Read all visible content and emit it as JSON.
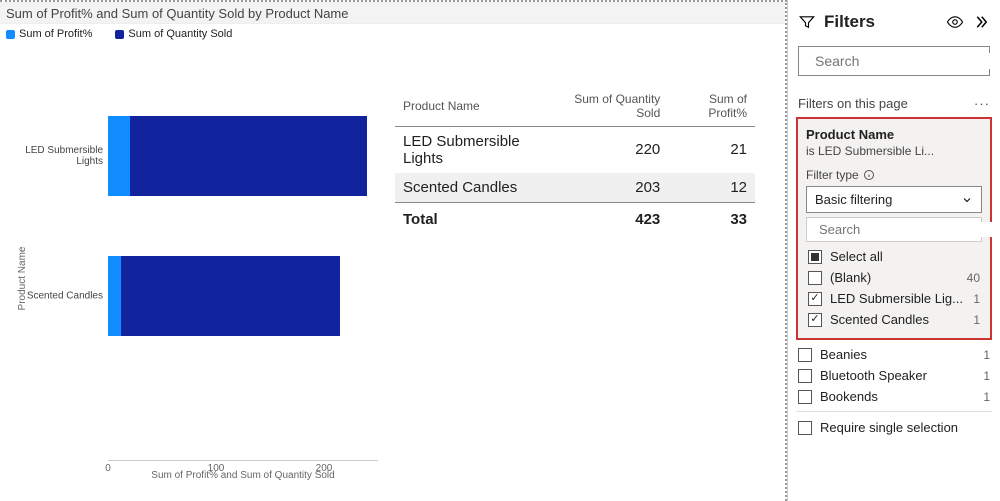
{
  "chart_data": {
    "type": "bar",
    "orientation": "horizontal",
    "stacked": true,
    "title": "Sum of Profit% and Sum of Quantity Sold by Product Name",
    "ylabel": "Product Name",
    "xlabel": "Sum of Profit% and Sum of Quantity Sold",
    "categories": [
      "LED Submersible Lights",
      "Scented Candles"
    ],
    "series": [
      {
        "name": "Sum of Profit%",
        "values": [
          21,
          12
        ],
        "color": "#118dff"
      },
      {
        "name": "Sum of Quantity Sold",
        "values": [
          220,
          203
        ],
        "color": "#12239e"
      }
    ],
    "xticks": [
      0,
      100,
      200
    ],
    "xlim": [
      0,
      250
    ]
  },
  "legend": [
    {
      "label": "Sum of Profit%",
      "color": "#118dff"
    },
    {
      "label": "Sum of Quantity Sold",
      "color": "#12239e"
    }
  ],
  "table": {
    "columns": [
      "Product Name",
      "Sum of Quantity Sold",
      "Sum of Profit%"
    ],
    "rows": [
      {
        "name": "LED Submersible Lights",
        "qty": "220",
        "profit": "21"
      },
      {
        "name": "Scented Candles",
        "qty": "203",
        "profit": "12"
      }
    ],
    "total": {
      "label": "Total",
      "qty": "423",
      "profit": "33"
    }
  },
  "filters": {
    "title": "Filters",
    "search_placeholder": "Search",
    "section_label": "Filters on this page",
    "card": {
      "title": "Product Name",
      "subtitle": "is LED Submersible Li...",
      "filter_type_label": "Filter type",
      "filter_type_value": "Basic filtering",
      "search_placeholder": "Search",
      "items": [
        {
          "label": "Select all",
          "count": "",
          "state": "partial"
        },
        {
          "label": "(Blank)",
          "count": "40",
          "state": "unchecked"
        },
        {
          "label": "LED Submersible Lig...",
          "count": "1",
          "state": "checked"
        },
        {
          "label": "Scented Candles",
          "count": "1",
          "state": "checked"
        }
      ]
    },
    "extra_items": [
      {
        "label": "Beanies",
        "count": "1",
        "state": "unchecked"
      },
      {
        "label": "Bluetooth Speaker",
        "count": "1",
        "state": "unchecked"
      },
      {
        "label": "Bookends",
        "count": "1",
        "state": "unchecked"
      }
    ],
    "require_single": "Require single selection"
  }
}
